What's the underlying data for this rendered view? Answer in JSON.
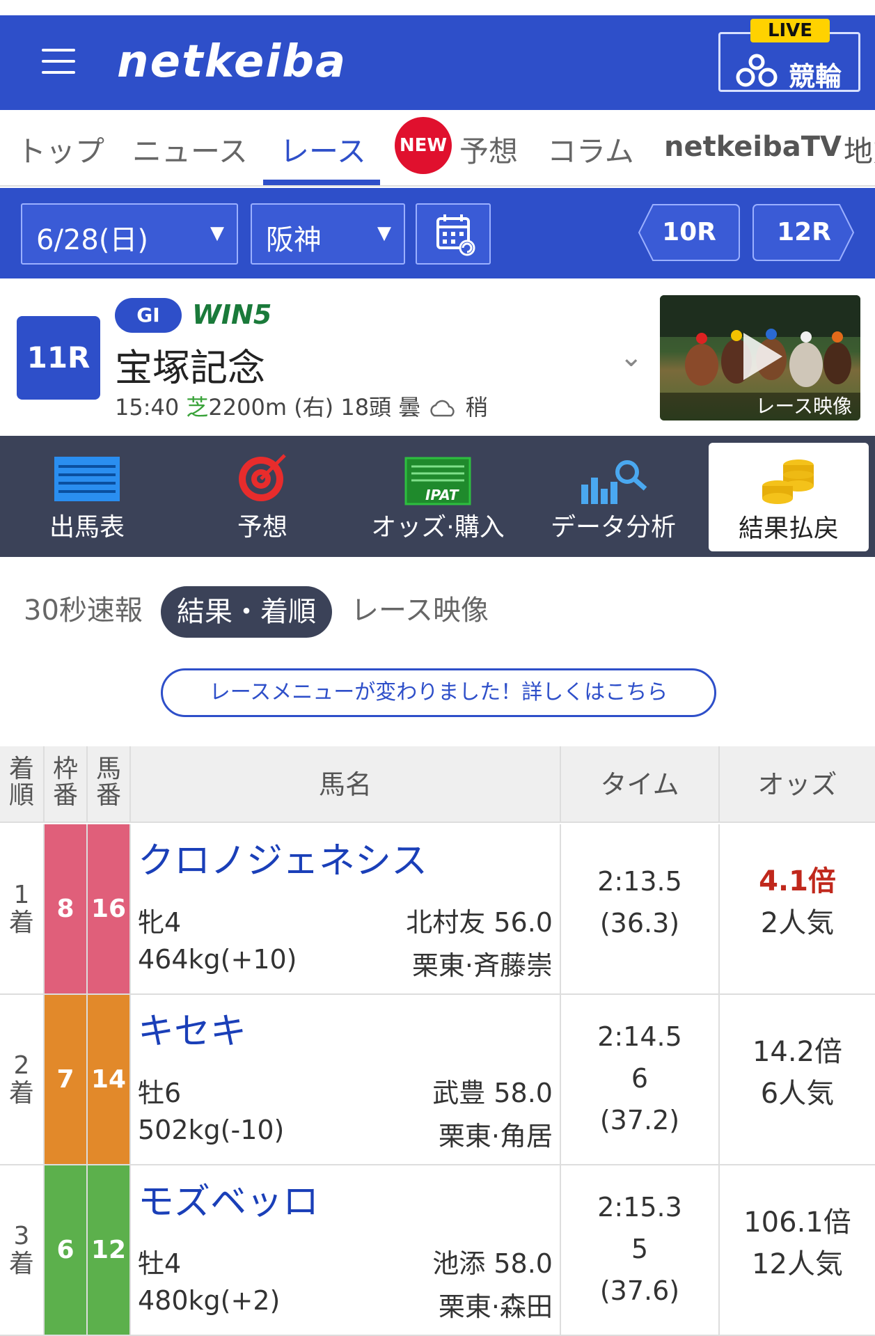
{
  "header": {
    "logo": "netkeiba",
    "live_badge": "LIVE",
    "keirin_label": "競輪"
  },
  "nav": {
    "tabs": [
      "トップ",
      "ニュース",
      "レース",
      "予想",
      "コラム",
      "netkeibaTV",
      "地方"
    ],
    "active": "レース",
    "new_badge": "NEW"
  },
  "selector": {
    "date": "6/28(日)",
    "venue": "阪神",
    "prev_race": "10R",
    "next_race": "12R"
  },
  "race": {
    "number": "11R",
    "grade": "GI",
    "win5": "WIN5",
    "name": "宝塚記念",
    "time": "15:40",
    "surface": "芝",
    "distance": "2200m (右) 18頭 曇",
    "condition": "稍",
    "video_label": "レース映像"
  },
  "menu": [
    {
      "label": "出馬表",
      "icon": "shutuba-icon"
    },
    {
      "label": "予想",
      "icon": "target-icon"
    },
    {
      "label": "オッズ·購入",
      "icon": "ipat-icon"
    },
    {
      "label": "データ分析",
      "icon": "chart-search-icon"
    },
    {
      "label": "結果払戻",
      "icon": "coins-icon"
    }
  ],
  "subtabs": {
    "t1": "30秒速報",
    "t2": "結果・着順",
    "t3": "レース映像"
  },
  "notice": "レースメニューが変わりました！詳しくはこちら",
  "table": {
    "headers": {
      "rank": "着順",
      "waku": "枠番",
      "umaban": "馬番",
      "name": "馬名",
      "time": "タイム",
      "odds": "オッズ"
    },
    "rows": [
      {
        "rank": "1",
        "rank_suffix": "着",
        "waku": "8",
        "umaban": "16",
        "waku_color": "#e05f7a",
        "name": "クロノジェネシス",
        "sex_age": "牝4",
        "weight": "464kg(+10)",
        "jockey": "北村友 56.0",
        "trainer": "栗東·斉藤崇",
        "time": "2:13.5",
        "margin": "",
        "last3f": "(36.3)",
        "odds": "4.1倍",
        "popularity": "2人気"
      },
      {
        "rank": "2",
        "rank_suffix": "着",
        "waku": "7",
        "umaban": "14",
        "waku_color": "#e2892a",
        "name": "キセキ",
        "sex_age": "牡6",
        "weight": "502kg(-10)",
        "jockey": "武豊 58.0",
        "trainer": "栗東·角居",
        "time": "2:14.5",
        "margin": "6",
        "last3f": "(37.2)",
        "odds": "14.2倍",
        "popularity": "6人気"
      },
      {
        "rank": "3",
        "rank_suffix": "着",
        "waku": "6",
        "umaban": "12",
        "waku_color": "#5cb04c",
        "name": "モズベッロ",
        "sex_age": "牡4",
        "weight": "480kg(+2)",
        "jockey": "池添 58.0",
        "trainer": "栗東·森田",
        "time": "2:15.3",
        "margin": "5",
        "last3f": "(37.6)",
        "odds": "106.1倍",
        "popularity": "12人気"
      }
    ]
  },
  "colors": {
    "brand": "#2e4fc9",
    "menu_bg": "#3b4258",
    "odds_favorite": "#c0281c"
  }
}
